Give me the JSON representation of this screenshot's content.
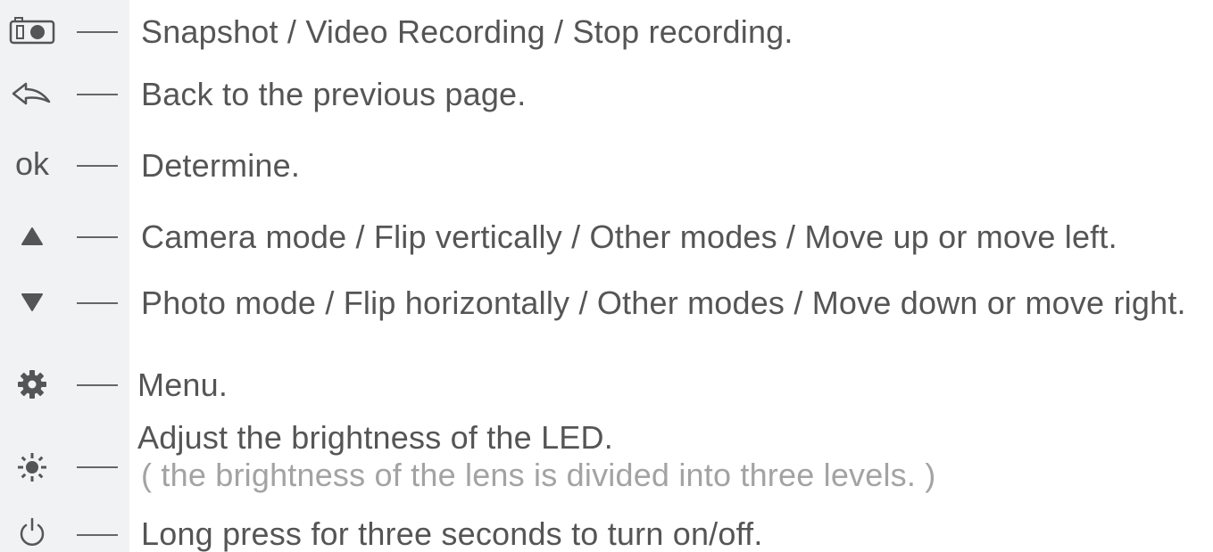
{
  "rows": [
    {
      "icon": "camera-record-icon",
      "text": "Snapshot / Video Recording / Stop recording."
    },
    {
      "icon": "back-arrow-icon",
      "text": "Back to the previous page."
    },
    {
      "icon": "ok-icon",
      "icon_text": "ok",
      "text": "Determine."
    },
    {
      "icon": "triangle-up-icon",
      "text": "Camera mode / Flip vertically / Other modes / Move up or move left."
    },
    {
      "icon": "triangle-down-icon",
      "text": "Photo mode / Flip horizontally / Other modes / Move down or move right."
    },
    {
      "icon": "gear-icon",
      "text": "Menu."
    },
    {
      "icon": "brightness-icon",
      "text": "Adjust the brightness of the LED.",
      "subtext": "( the brightness of the lens is divided into three levels. )"
    },
    {
      "icon": "power-icon",
      "text": "Long press for three seconds to turn on/off."
    }
  ]
}
